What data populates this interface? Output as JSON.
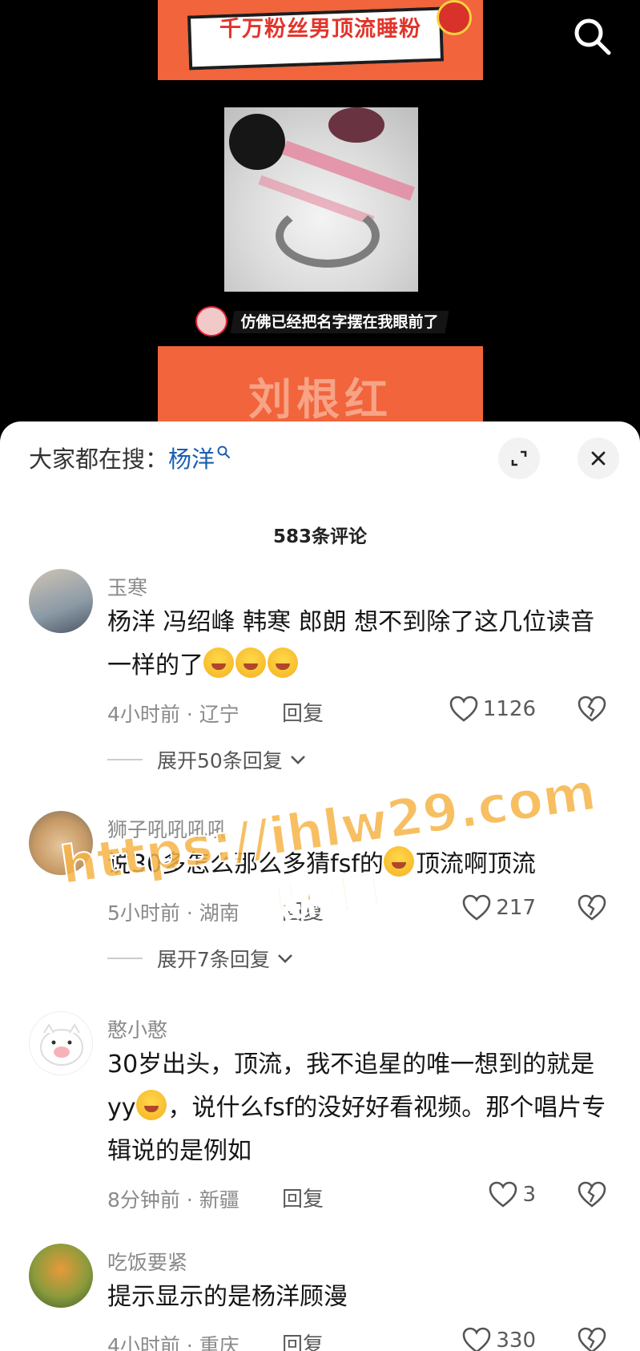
{
  "video": {
    "banner_title": "千万粉丝男顶流睡粉",
    "caption": "仿佛已经把名字摆在我眼前了",
    "bottom_title": "刘根红"
  },
  "sheet": {
    "hot_search_label": "大家都在搜：",
    "hot_search_keyword": "杨洋",
    "comment_count": "583条评论"
  },
  "comments": [
    {
      "username": "玉寒",
      "text": "杨洋 冯绍峰 韩寒 郎朗 想不到除了这几位读音一样的了",
      "emoji": [
        "crying-laughing",
        "crying-laughing",
        "crying-laughing"
      ],
      "meta": "4小时前 · 辽宁",
      "reply_label": "回复",
      "likes": "1126",
      "expand_label": "展开50条回复"
    },
    {
      "username": "狮子吼吼吼吼",
      "text_before": "说30多怎么那么多猜fsf的",
      "text_after": "顶流啊顶流",
      "emoji": [
        "thinking"
      ],
      "meta": "5小时前 · 湖南",
      "reply_label": "回复",
      "likes": "217",
      "expand_label": "展开7条回复"
    },
    {
      "username": "憨小憨",
      "text_before": "30岁出头，顶流，我不追星的唯一想到的就是yy",
      "text_after": "，说什么fsf的没好好看视频。那个唱片专辑说的是例如",
      "emoji": [
        "rofl"
      ],
      "meta": "8分钟前 · 新疆",
      "reply_label": "回复",
      "likes": "3"
    },
    {
      "username": "吃饭要紧",
      "text": "提示显示的是杨洋顾漫",
      "meta": "4小时前 · 重庆",
      "reply_label": "回复",
      "likes": "330"
    }
  ],
  "watermark": {
    "url": "https://ihlw29.com",
    "cn": "黑料网"
  }
}
